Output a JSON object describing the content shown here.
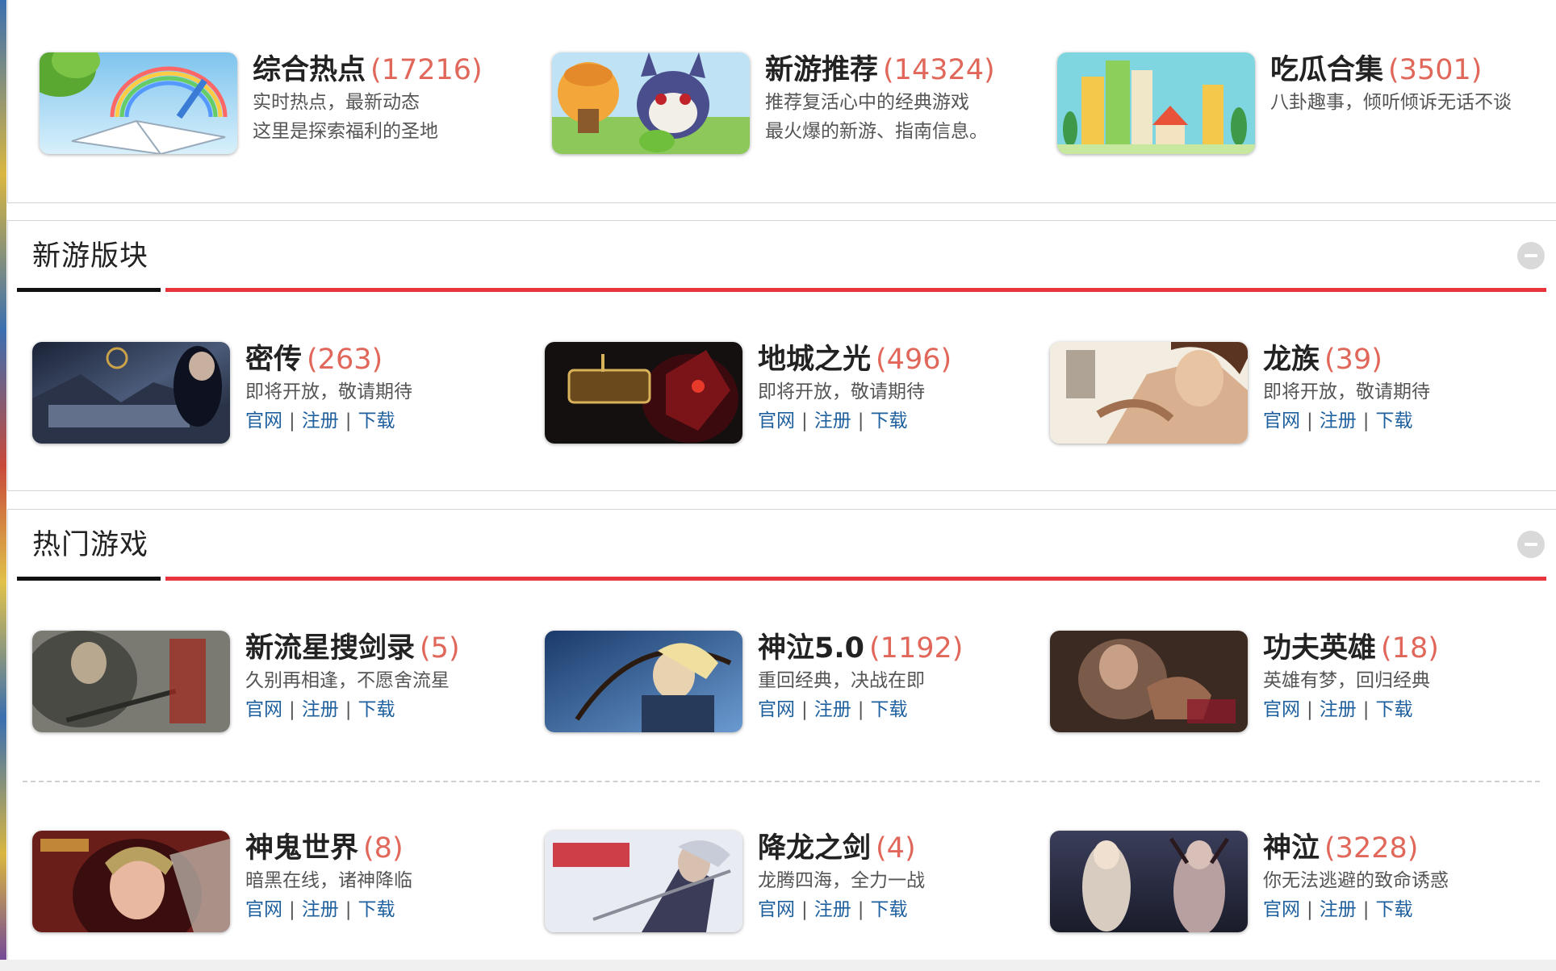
{
  "colors": {
    "accent_red": "#e8343c",
    "count_color": "#e0675a",
    "link_blue": "#1e5f9e"
  },
  "top_section": {
    "cards": [
      {
        "name": "综合热点",
        "count": "(17216)",
        "line1": "实时热点，最新动态",
        "line2": "这里是探索福利的圣地",
        "thumb": "book-rainbow-image"
      },
      {
        "name": "新游推荐",
        "count": "(14324)",
        "line1": "推荐复活心中的经典游戏",
        "line2": "最火爆的新游、指南信息。",
        "thumb": "cartoon-wolf-image"
      },
      {
        "name": "吃瓜合集",
        "count": "(3501)",
        "line1": "八卦趣事，倾听倾诉无话不谈",
        "line2": "",
        "thumb": "city-buildings-image"
      }
    ]
  },
  "new_games_section": {
    "title": "新游版块",
    "cards": [
      {
        "name": "密传",
        "count": "(263)",
        "desc": "即将开放，敬请期待",
        "thumb": "zhushen-fuhuo-banner"
      },
      {
        "name": "地城之光",
        "count": "(496)",
        "desc": "即将开放，敬请期待",
        "thumb": "dicheng-zhiguang-banner"
      },
      {
        "name": "龙族",
        "count": "(39)",
        "desc": "即将开放，敬请期待",
        "thumb": "longzu-banner"
      }
    ]
  },
  "hot_games_section": {
    "title": "热门游戏",
    "cards": [
      {
        "name": "新流星搜剑录",
        "count": "(5)",
        "desc": "久别再相逢，不愿舍流星",
        "thumb": "liuxing-banner"
      },
      {
        "name": "神泣5.0",
        "count": "(1192)",
        "desc": "重回经典，决战在即",
        "thumb": "shenqi5-banner"
      },
      {
        "name": "功夫英雄",
        "count": "(18)",
        "desc": "英雄有梦，回归经典",
        "thumb": "gongfu-banner"
      },
      {
        "name": "神鬼世界",
        "count": "(8)",
        "desc": "暗黑在线，诸神降临",
        "thumb": "shengui-banner"
      },
      {
        "name": "降龙之剑",
        "count": "(4)",
        "desc": "龙腾四海，全力一战",
        "thumb": "xianglong-banner"
      },
      {
        "name": "神泣",
        "count": "(3228)",
        "desc": "你无法逃避的致命诱惑",
        "thumb": "shenqi-banner"
      }
    ]
  },
  "links": {
    "official": "官网",
    "register": "注册",
    "download": "下载",
    "separator": "|"
  }
}
